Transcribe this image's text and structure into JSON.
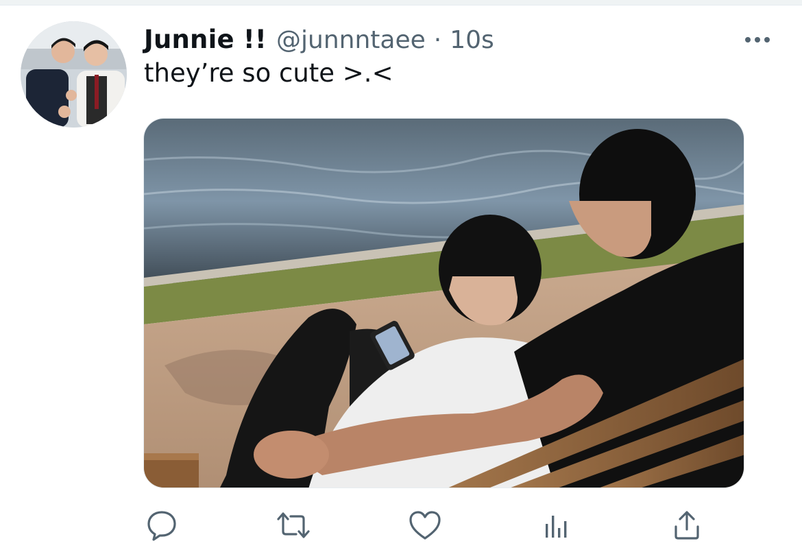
{
  "tweet": {
    "display_name": "Junnie !!",
    "handle": "@junnntaee",
    "separator": "·",
    "time": "10s",
    "text": "they’re so cute >.<"
  },
  "icons": {
    "avatar": "profile-photo",
    "more": "more-dots-icon",
    "reply": "reply-icon",
    "retweet": "retweet-icon",
    "like": "heart-icon",
    "analytics": "analytics-icon",
    "share": "share-icon"
  },
  "colors": {
    "text_primary": "#0f1419",
    "text_secondary": "#536471",
    "icon_gray": "#536471"
  }
}
